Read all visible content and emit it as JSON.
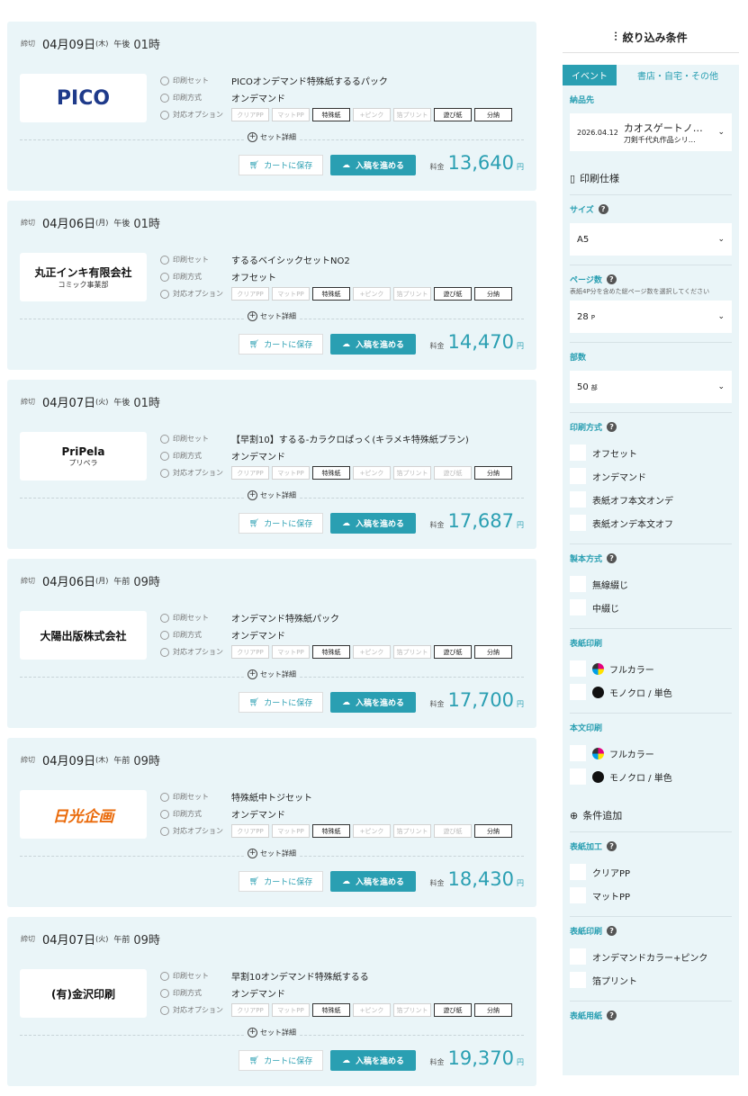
{
  "labels": {
    "deadline": "締切",
    "print_set": "印刷セット",
    "print_method": "印刷方式",
    "options": "対応オプション",
    "set_detail": "セット詳細",
    "cart": "カートに保存",
    "submit": "入稿を進める",
    "price": "料金",
    "yen": "円"
  },
  "option_names": [
    "クリアPP",
    "マットPP",
    "特殊紙",
    "+ピンク",
    "箔プリント",
    "遊び紙",
    "分納"
  ],
  "cards": [
    {
      "date": "04月09日",
      "dow": "(木)",
      "ampm": "午後",
      "time": "01時",
      "logo": "PICO",
      "set": "PICOオンデマンド特殊紙するるパック",
      "method": "オンデマンド",
      "price": "13,640",
      "opts_on": [
        2,
        5,
        6
      ]
    },
    {
      "date": "04月06日",
      "dow": "(月)",
      "ampm": "午後",
      "time": "01時",
      "logo": "丸正インキ有限会社",
      "logo_sub": "コミック事業部",
      "set": "するるベイシックセットNO2",
      "method": "オフセット",
      "price": "14,470",
      "opts_on": [
        2,
        5,
        6
      ]
    },
    {
      "date": "04月07日",
      "dow": "(火)",
      "ampm": "午後",
      "time": "01時",
      "logo": "PriPela",
      "logo_sub": "プリペラ",
      "set": "【早割10】するる-カラクロぱっく(キラメキ特殊紙プラン)",
      "method": "オンデマンド",
      "price": "17,687",
      "opts_on": [
        2,
        6
      ]
    },
    {
      "date": "04月06日",
      "dow": "(月)",
      "ampm": "午前",
      "time": "09時",
      "logo": "大陽出版株式会社",
      "set": "オンデマンド特殊紙パック",
      "method": "オンデマンド",
      "price": "17,700",
      "opts_on": [
        2,
        5,
        6
      ]
    },
    {
      "date": "04月09日",
      "dow": "(木)",
      "ampm": "午前",
      "time": "09時",
      "logo": "日光企画",
      "set": "特殊紙中トジセット",
      "method": "オンデマンド",
      "price": "18,430",
      "opts_on": [
        2,
        6
      ]
    },
    {
      "date": "04月07日",
      "dow": "(火)",
      "ampm": "午前",
      "time": "09時",
      "logo": "(有)金沢印刷",
      "set": "早割10オンデマンド特殊紙するる",
      "method": "オンデマンド",
      "price": "19,370",
      "opts_on": [
        2,
        5,
        6
      ]
    }
  ],
  "sidebar": {
    "title": "絞り込み条件",
    "tabs": [
      "イベント",
      "書店・自宅・その他"
    ],
    "delivery_label": "納品先",
    "delivery_date": "2026.04.12",
    "delivery_event": "カオスゲートノ…",
    "delivery_sub": "刀剣千代丸作品シリ…",
    "spec_title": "印刷仕様",
    "size_label": "サイズ",
    "size_value": "A5",
    "pages_label": "ページ数",
    "pages_hint": "表紙4P分を含めた総ページ数を選択してください",
    "pages_value": "28",
    "pages_unit": "P",
    "copies_label": "部数",
    "copies_value": "50",
    "copies_unit": "部",
    "method_label": "印刷方式",
    "methods": [
      "オフセット",
      "オンデマンド",
      "表紙オフ本文オンデ",
      "表紙オンデ本文オフ"
    ],
    "binding_label": "製本方式",
    "bindings": [
      "無線綴じ",
      "中綴じ"
    ],
    "cover_print_label": "表紙印刷",
    "cover_prints": [
      "フルカラー",
      "モノクロ / 単色"
    ],
    "body_print_label": "本文印刷",
    "body_prints": [
      "フルカラー",
      "モノクロ / 単色"
    ],
    "extra_title": "条件追加",
    "cover_finish_label": "表紙加工",
    "cover_finishes": [
      "クリアPP",
      "マットPP"
    ],
    "cover_print2_label": "表紙印刷",
    "cover_print2": [
      "オンデマンドカラー+ピンク",
      "箔プリント"
    ],
    "cover_paper_label": "表紙用紙"
  }
}
